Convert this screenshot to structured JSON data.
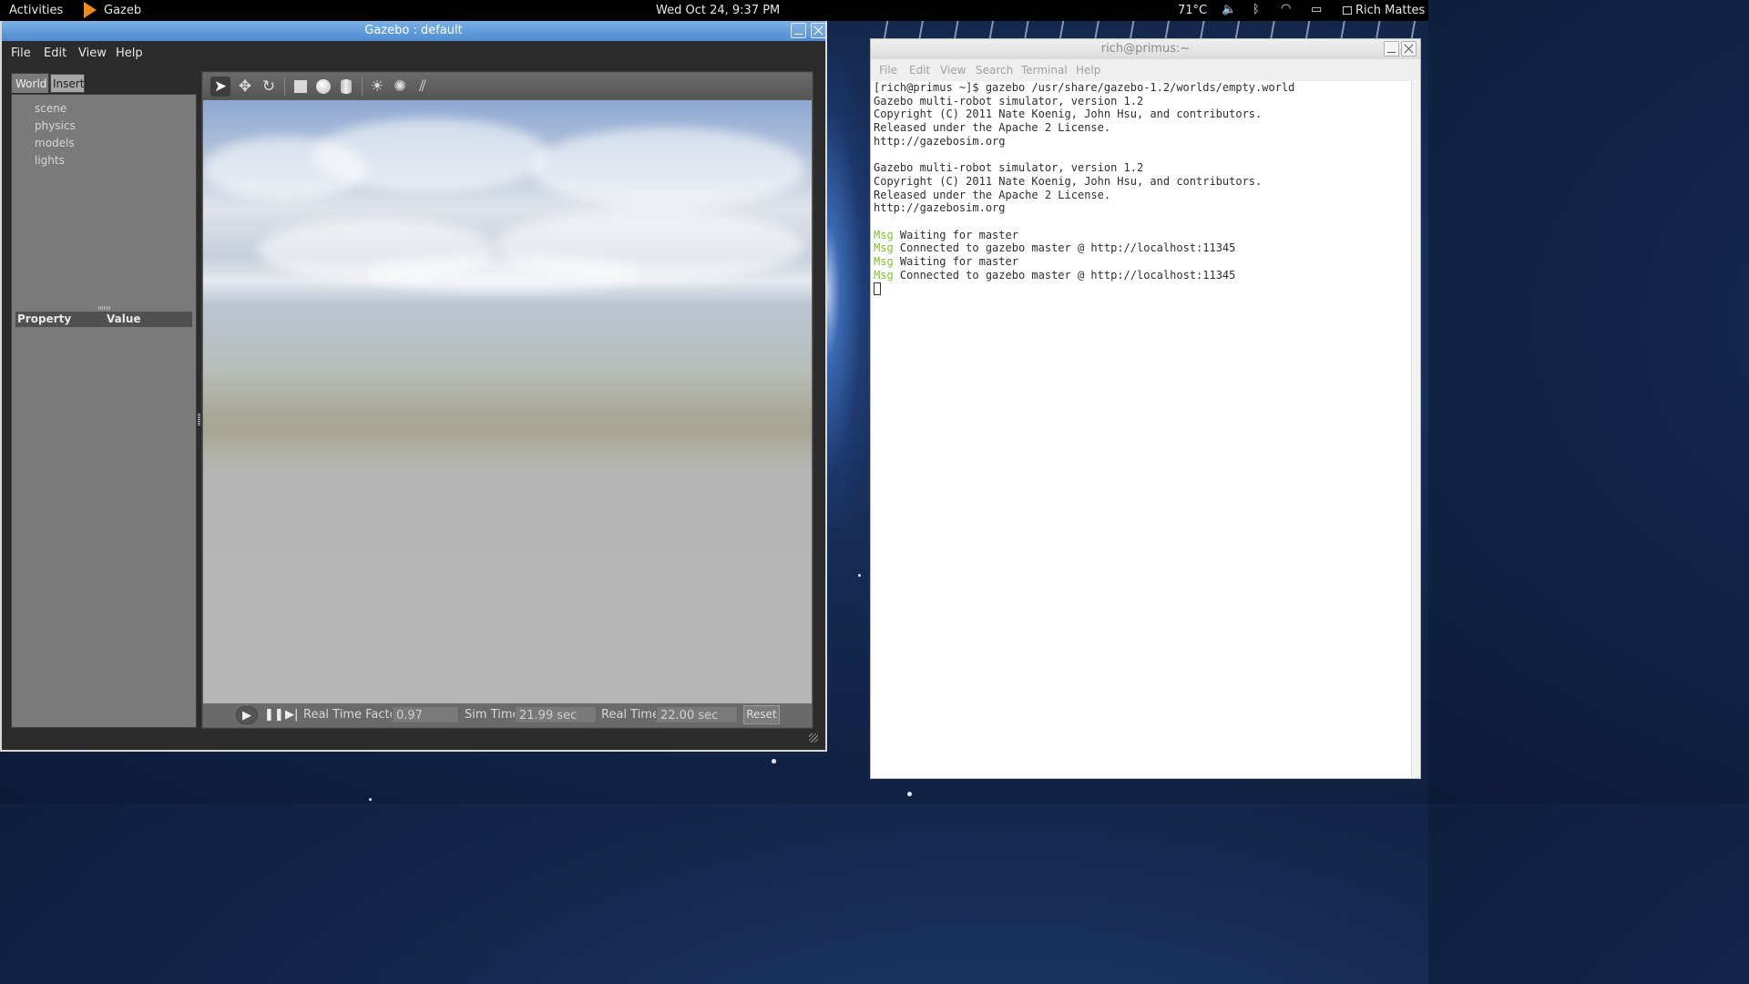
{
  "topbar": {
    "activities": "Activities",
    "app_name": "Gazeb",
    "clock": "Wed Oct 24,  9:37 PM",
    "temperature": "71°C",
    "user": "Rich Mattes"
  },
  "gazebo": {
    "title": "Gazebo : default",
    "menu": [
      "File",
      "Edit",
      "View",
      "Help"
    ],
    "tabs": [
      "World",
      "Insert"
    ],
    "tree": [
      "scene",
      "physics",
      "models",
      "lights"
    ],
    "property_header": {
      "property": "Property",
      "value": "Value"
    },
    "status": {
      "real_time_factor_label": "Real Time Factor:",
      "real_time_factor": "0.97",
      "sim_time_label": "Sim Time:",
      "sim_time": "21.99 sec",
      "real_time_label": "Real Time:",
      "real_time": "22.00 sec",
      "reset_label": "Reset"
    },
    "toolbar_icons": [
      "arrow-select-icon",
      "move-icon",
      "rotate-icon",
      "box-icon",
      "sphere-icon",
      "cylinder-icon",
      "point-light-icon",
      "spot-light-icon",
      "directional-light-icon"
    ]
  },
  "terminal": {
    "title": "rich@primus:~",
    "menu": [
      "File",
      "Edit",
      "View",
      "Search",
      "Terminal",
      "Help"
    ],
    "lines": [
      "[rich@primus ~]$ gazebo /usr/share/gazebo-1.2/worlds/empty.world",
      "Gazebo multi-robot simulator, version 1.2",
      "Copyright (C) 2011 Nate Koenig, John Hsu, and contributors.",
      "Released under the Apache 2 License.",
      "http://gazebosim.org",
      "",
      "Gazebo multi-robot simulator, version 1.2",
      "Copyright (C) 2011 Nate Koenig, John Hsu, and contributors.",
      "Released under the Apache 2 License.",
      "http://gazebosim.org",
      ""
    ],
    "msg_lines": [
      {
        "tag": "Msg",
        "text": " Waiting for master"
      },
      {
        "tag": "Msg",
        "text": " Connected to gazebo master @ http://localhost:11345"
      },
      {
        "tag": "Msg",
        "text": " Waiting for master"
      },
      {
        "tag": "Msg",
        "text": " Connected to gazebo master @ http://localhost:11345"
      }
    ]
  },
  "colors": {
    "gazebo_titlebar": "#4d8cd1",
    "terminal_msg": "#7ec229",
    "desktop": "#14284d"
  }
}
